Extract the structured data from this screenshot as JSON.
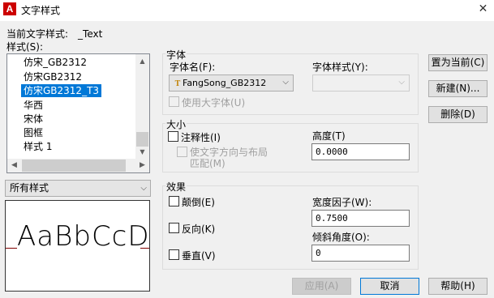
{
  "window": {
    "title": "文字样式",
    "app_icon": "A"
  },
  "current_style": {
    "label": "当前文字样式:",
    "value": "_Text"
  },
  "styles": {
    "label": "样式(S):",
    "items": [
      "仿宋_GB2312",
      "仿宋GB2312",
      "仿宋GB2312_T3",
      "华西",
      "宋体",
      "图框",
      "样式 1"
    ],
    "selected_index": 2
  },
  "filter": {
    "value": "所有样式"
  },
  "preview": {
    "sample_text": "AaBbCcD"
  },
  "font_group": {
    "title": "字体",
    "font_name_label": "字体名(F):",
    "font_name_value": "FangSong_GB2312",
    "font_style_label": "字体样式(Y):",
    "font_style_value": "",
    "use_big_font_label": "使用大字体(U)"
  },
  "size_group": {
    "title": "大小",
    "annotative_label": "注释性(I)",
    "match_orientation_label_line1": "使文字方向与布局",
    "match_orientation_label_line2": "匹配(M)",
    "height_label": "高度(T)",
    "height_value": "0.0000"
  },
  "effects_group": {
    "title": "效果",
    "upside_down_label": "颠倒(E)",
    "backwards_label": "反向(K)",
    "vertical_label": "垂直(V)",
    "width_factor_label": "宽度因子(W):",
    "width_factor_value": "0.7500",
    "oblique_angle_label": "倾斜角度(O):",
    "oblique_angle_value": "0"
  },
  "buttons": {
    "set_current": "置为当前(C)",
    "new": "新建(N)...",
    "delete": "删除(D)",
    "apply": "应用(A)",
    "cancel": "取消",
    "help": "帮助(H)"
  },
  "colors": {
    "selection": "#0078d7",
    "baseline": "#800000"
  }
}
